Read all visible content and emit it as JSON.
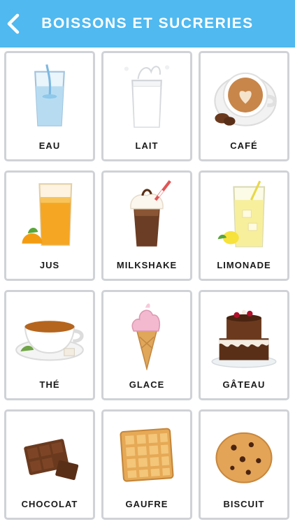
{
  "header": {
    "title": "BOISSONS ET SUCRERIES",
    "back_icon": "chevron-left-icon",
    "color": "#4fb9f0"
  },
  "items": [
    {
      "label": "EAU",
      "icon": "water-glass-icon"
    },
    {
      "label": "LAIT",
      "icon": "milk-glass-icon"
    },
    {
      "label": "CAFÉ",
      "icon": "coffee-cup-icon"
    },
    {
      "label": "JUS",
      "icon": "juice-glass-icon"
    },
    {
      "label": "MILKSHAKE",
      "icon": "milkshake-icon"
    },
    {
      "label": "LIMONADE",
      "icon": "lemonade-glass-icon"
    },
    {
      "label": "THÉ",
      "icon": "tea-cup-icon"
    },
    {
      "label": "GLACE",
      "icon": "ice-cream-cone-icon"
    },
    {
      "label": "GÂTEAU",
      "icon": "cake-icon"
    },
    {
      "label": "CHOCOLAT",
      "icon": "chocolate-bar-icon"
    },
    {
      "label": "GAUFRE",
      "icon": "waffle-icon"
    },
    {
      "label": "BISCUIT",
      "icon": "cookie-icon"
    }
  ]
}
